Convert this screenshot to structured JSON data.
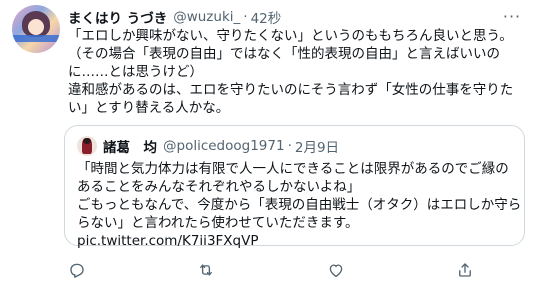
{
  "tweet": {
    "display_name": "まくはり うづき",
    "handle": "@wuzuki_",
    "separator": "·",
    "time": "42秒",
    "body_lines": [
      "「エロしか興味がない、守りたくない」というのももちろん良いと思う。",
      "（その場合「表現の自由」ではなく「性的表現の自由」と言えばいいの",
      "に……とは思うけど）",
      "違和感があるのは、エロを守りたいのにそう言わず「女性の仕事を守りた",
      "い」とすり替える人かな。"
    ]
  },
  "quoted_tweet": {
    "display_name": "諸葛　均",
    "handle": "@policedoog1971",
    "separator": "·",
    "date": "2月9日",
    "body_lines": [
      "「時間と気力体力は有限で人一人にできることは限界があるのでご縁の",
      "あることをみんなそれぞれやるしかないよね」",
      "ごもっともなんで、今度から「表現の自由戦士（オタク）はエロしか守ら",
      "らない」と言われたら使わせていただきます。",
      "pic.twitter.com/K7ii3FXqVP"
    ]
  },
  "icons": {
    "more": "more-icon",
    "reply": "reply-icon",
    "retweet": "retweet-icon",
    "like": "like-icon",
    "share": "share-icon"
  },
  "colors": {
    "text": "#0f1419",
    "muted": "#536471",
    "border": "#cfd9de"
  }
}
